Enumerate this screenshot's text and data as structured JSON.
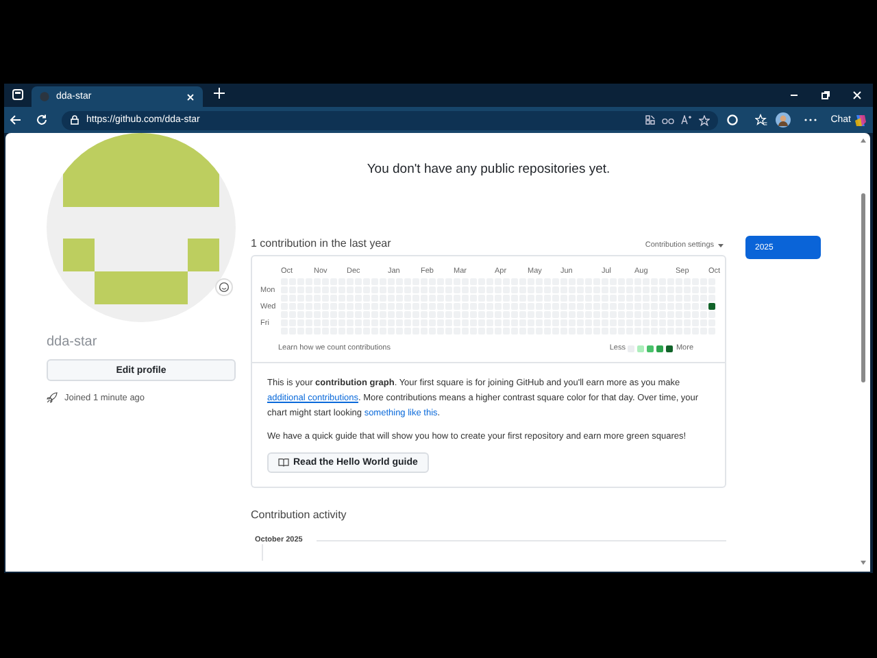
{
  "browser": {
    "tabs": [
      {
        "title": "dda-star",
        "selected": true
      }
    ],
    "address": "https://github.com/dda-star",
    "chat_label": "Chat"
  },
  "profile": {
    "username": "dda-star",
    "edit_button": "Edit profile",
    "joined": "Joined 1 minute ago"
  },
  "repositories_notice": "You don't have any public repositories yet.",
  "contributions": {
    "summary": "1 contribution in the last year",
    "settings_label": "Contribution settings",
    "months": [
      "Oct",
      "Nov",
      "Dec",
      "Jan",
      "Feb",
      "Mar",
      "Apr",
      "May",
      "Jun",
      "Jul",
      "Aug",
      "Sep",
      "Oct"
    ],
    "days": [
      "Mon",
      "Wed",
      "Fri"
    ],
    "learn_link": "Learn how we count contributions",
    "legend": {
      "less": "Less",
      "more": "More",
      "swatches": [
        {
          "color": "#ebedf0"
        },
        {
          "color": "#aceebb"
        },
        {
          "color": "#4ac26b"
        },
        {
          "color": "#2da44e"
        },
        {
          "color": "#116329"
        }
      ]
    }
  },
  "years": [
    {
      "label": "2025",
      "selected": true
    }
  ],
  "info": {
    "paragraph": [
      {
        "kind": "text",
        "text": "This is your **contribution graph**. Your first square is for joining GitHub and you'll earn more as you make "
      },
      {
        "kind": "link",
        "text": "additional contributions"
      },
      {
        "kind": "text",
        "text": ". More contributions means a higher contrast square color for that day. Over time, your chart might start looking "
      },
      {
        "kind": "link",
        "text": "something like this"
      },
      {
        "kind": "text",
        "text": "."
      }
    ],
    "guide_text": "We have a quick guide that will show you how to create your first repository and earn more green squares!",
    "guide_button": "Read the Hello World guide"
  },
  "activity": {
    "heading": "Contribution activity",
    "month": "October 2025"
  }
}
